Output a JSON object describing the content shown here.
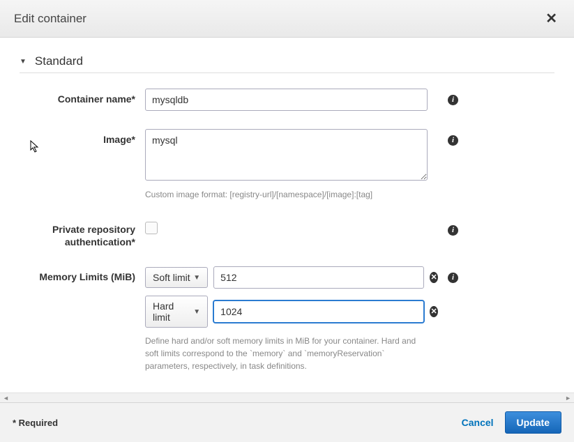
{
  "modal": {
    "title": "Edit container",
    "close_glyph": "✕"
  },
  "section": {
    "title": "Standard",
    "caret_glyph": "▼"
  },
  "fields": {
    "container_name": {
      "label": "Container name*",
      "value": "mysqldb"
    },
    "image": {
      "label": "Image*",
      "value": "mysql",
      "hint": "Custom image format: [registry-url]/[namespace]/[image]:[tag]"
    },
    "private_repo": {
      "label": "Private repository authentication*",
      "checked": false
    },
    "memory": {
      "label": "Memory Limits (MiB)",
      "rows": [
        {
          "type": "Soft limit",
          "value": "512"
        },
        {
          "type": "Hard limit",
          "value": "1024"
        }
      ],
      "hint": "Define hard and/or soft memory limits in MiB for your container. Hard and soft limits correspond to the `memory` and `memoryReservation` parameters, respectively, in task definitions."
    }
  },
  "footer": {
    "required_note": "* Required",
    "cancel": "Cancel",
    "update": "Update"
  },
  "icons": {
    "info_glyph": "i",
    "remove_glyph": "✕",
    "dropdown_caret": "▼",
    "scroll_left": "◄",
    "scroll_right": "►"
  }
}
